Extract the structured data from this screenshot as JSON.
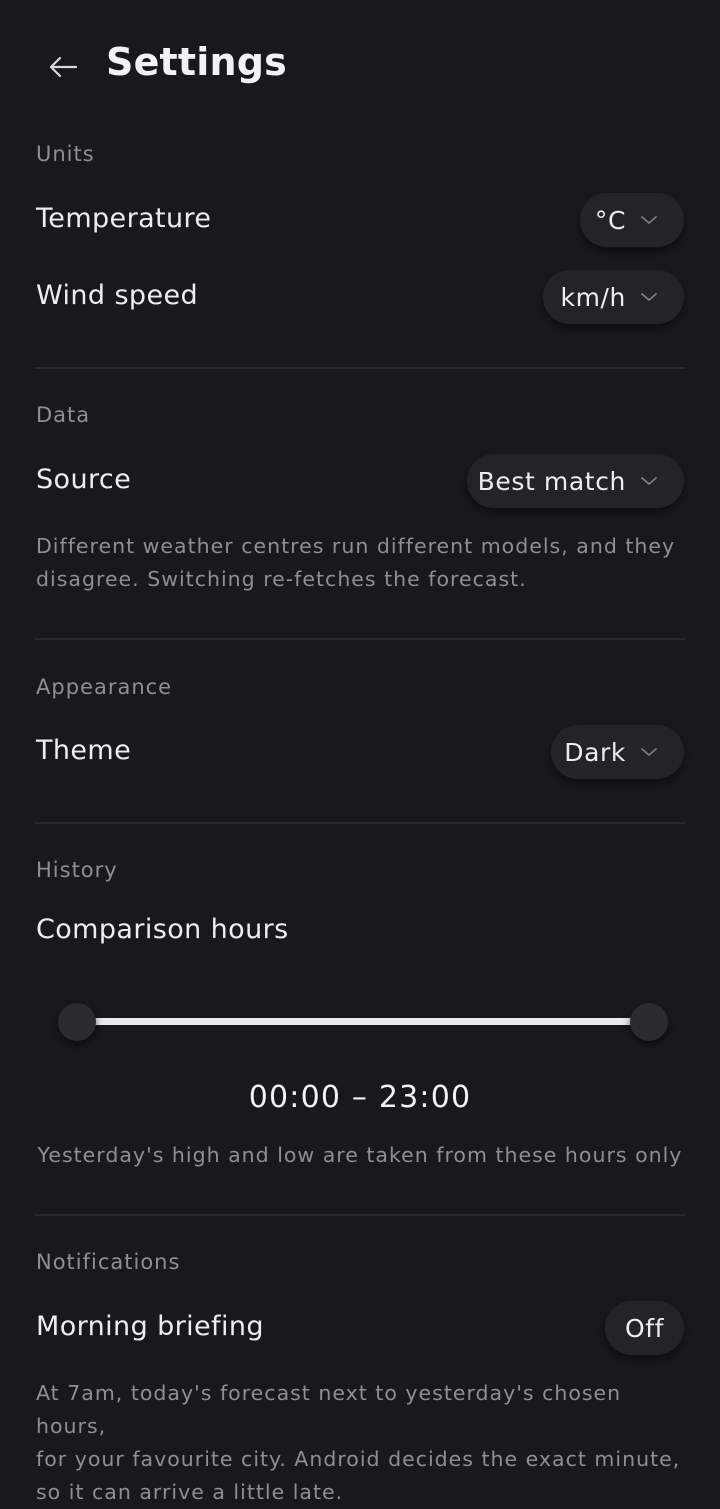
{
  "header": {
    "title": "Settings",
    "back_icon": "arrow-left-icon"
  },
  "units": {
    "section": "Units",
    "temperature": {
      "label": "Temperature",
      "value": "°C"
    },
    "wind_speed": {
      "label": "Wind speed",
      "value": "km/h"
    }
  },
  "data": {
    "section": "Data",
    "source": {
      "label": "Source",
      "value": "Best match"
    },
    "description_line1": "Different weather centres run different models, and they",
    "description_line2": "disagree. Switching re-fetches the forecast."
  },
  "appearance": {
    "section": "Appearance",
    "theme": {
      "label": "Theme",
      "value": "Dark"
    }
  },
  "history": {
    "section": "History",
    "comparison_label": "Comparison hours",
    "range_text": "00:00 – 23:00",
    "range_start_fraction": 0.0,
    "range_end_fraction": 1.0,
    "caption": "Yesterday's high and low are taken from these hours only"
  },
  "notifications": {
    "section": "Notifications",
    "morning_briefing": {
      "label": "Morning briefing",
      "value": "Off"
    },
    "description_line1": "At 7am, today's forecast next to yesterday's chosen hours,",
    "description_line2": "for your favourite city. Android decides the exact minute,",
    "description_line3": "so it can arrive a little late."
  },
  "colors": {
    "background": "#18191d",
    "surface": "#232429",
    "text": "#ededf0",
    "muted": "#8e8f96"
  }
}
